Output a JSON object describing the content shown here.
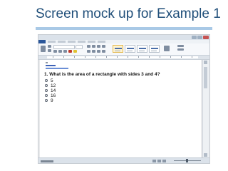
{
  "slide": {
    "title": "Screen mock up for Example 1"
  },
  "quiz": {
    "question": "1. What is the area of a rectangle with sides 3 and 4?",
    "answers": [
      "5",
      "12",
      "14",
      "16",
      "9"
    ]
  },
  "colors": {
    "title_text": "#1f4e79",
    "accent_bar": "#a9c9e6",
    "word_blue": "#2b579a"
  }
}
